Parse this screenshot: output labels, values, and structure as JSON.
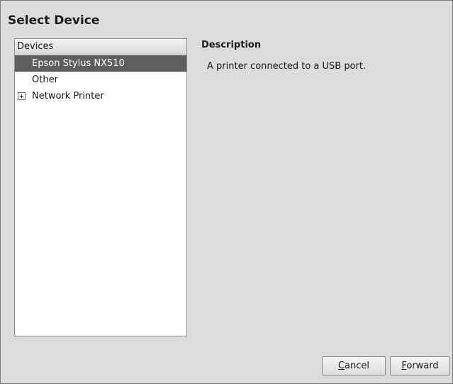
{
  "dialog": {
    "title": "Select Device"
  },
  "device_list": {
    "header": "Devices",
    "items": [
      {
        "label": "Epson Stylus NX510",
        "selected": true,
        "expandable": false
      },
      {
        "label": "Other",
        "selected": false,
        "expandable": false
      },
      {
        "label": "Network Printer",
        "selected": false,
        "expandable": true
      }
    ]
  },
  "description": {
    "heading": "Description",
    "text": "A printer connected to a USB port."
  },
  "buttons": {
    "cancel": {
      "mnemonic": "C",
      "rest": "ancel"
    },
    "forward": {
      "mnemonic": "F",
      "rest": "orward"
    }
  }
}
